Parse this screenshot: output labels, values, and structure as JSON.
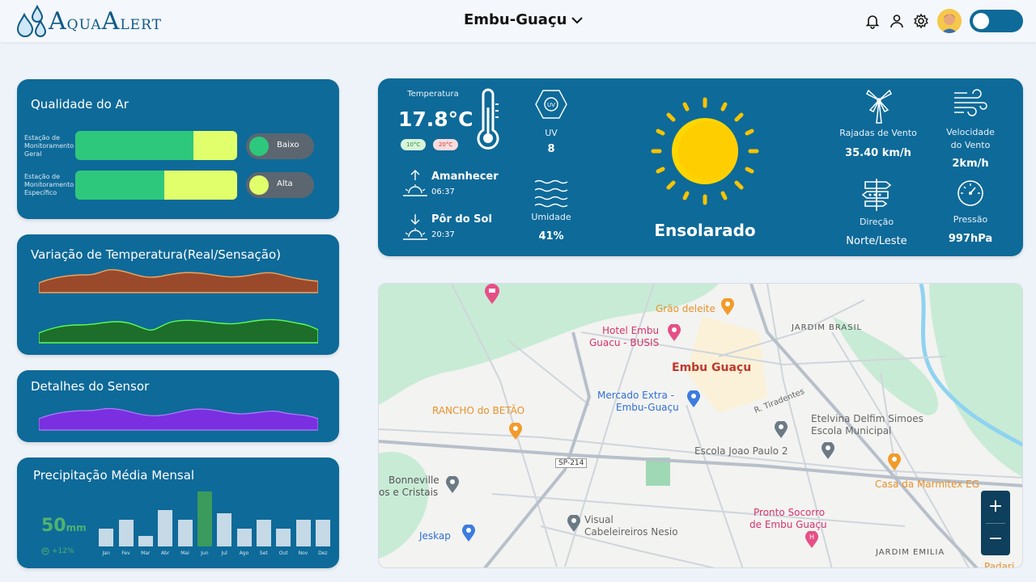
{
  "header": {
    "logo_text_a": "A",
    "logo_text_qua": "QUA",
    "logo_text_a2": "A",
    "logo_text_lert": "LERT",
    "city": "Embu-Guaçu"
  },
  "air_quality": {
    "title": "Qualidade do Ar",
    "rows": [
      {
        "label": "Estação de Monitoramento Geral",
        "green_fraction": 0.73,
        "status": "Baixo",
        "dot_color": "#2ec87c"
      },
      {
        "label": "Estação de Monitoramento Específico",
        "green_fraction": 0.55,
        "status": "Alta",
        "dot_color": "#e1ff6a"
      }
    ]
  },
  "temp_variation": {
    "title": "Variação de Temperatura(Real/Sensação)"
  },
  "sensor": {
    "title": "Detalhes do Sensor"
  },
  "precip": {
    "title": "Precipitação Média Mensal",
    "value": "50",
    "unit": "mm",
    "change": "+12%",
    "chart_data": {
      "type": "bar",
      "categories": [
        "Jan",
        "Fev",
        "Mar",
        "Abr",
        "Mai",
        "Jun",
        "Jul",
        "Ago",
        "Set",
        "Out",
        "Nov",
        "Dez"
      ],
      "values": [
        22,
        33,
        13,
        45,
        33,
        68,
        41,
        22,
        33,
        22,
        33,
        33
      ],
      "highlight_index": 5,
      "ylim": [
        0,
        70
      ]
    }
  },
  "weather": {
    "temp_label": "Temperatura",
    "temp_value": "17.8°C",
    "temp_min": "10°C",
    "temp_max": "20°C",
    "uv_label": "UV",
    "uv_value": "8",
    "sunrise_label": "Amanhecer",
    "sunrise_time": "06:37",
    "sunset_label": "Pôr do Sol",
    "sunset_time": "20:37",
    "humidity_label": "Umidade",
    "humidity_value": "41%",
    "condition": "Ensolarado",
    "gusts_label": "Rajadas de Vento",
    "gusts_value": "35.40 km/h",
    "wind_label_1": "Velocidade",
    "wind_label_2": "do Vento",
    "wind_value": "2km/h",
    "direction_label": "Direção",
    "direction_value": "Norte/Leste",
    "pressure_label": "Pressão",
    "pressure_value": "997hPa"
  },
  "map": {
    "labels": {
      "grao": "Grão deleite",
      "hotel1": "Hotel Embu",
      "hotel2": "Guacu - BUSIS",
      "jardim_brasil": "JARDIM BRASIL",
      "embu": "Embu Guaçu",
      "mercado1": "Mercado Extra -",
      "mercado2": "Embu-Guaçu",
      "rancho": "RANCHO do BETÃO",
      "tiradentes": "R. Tiradentes",
      "etelvina1": "Etelvina Delfim Simoes",
      "etelvina2": "Escola Municipal",
      "escola": "Escola Joao Paulo 2",
      "sp214": "SP-214",
      "bonneville1": "Bonneville",
      "bonneville2": "os e Cristais",
      "casa": "Casa da Marmitex EG",
      "visual1": "Visual",
      "visual2": "Cabeleireiros Nesio",
      "pronto1": "Pronto Socorro",
      "pronto2": "de Embu Guaçu",
      "jeskap": "Jeskap",
      "jardim_emilia": "JARDIM EMILIA",
      "padaria": "Padari"
    },
    "zoom_in": "+",
    "zoom_out": "−"
  }
}
